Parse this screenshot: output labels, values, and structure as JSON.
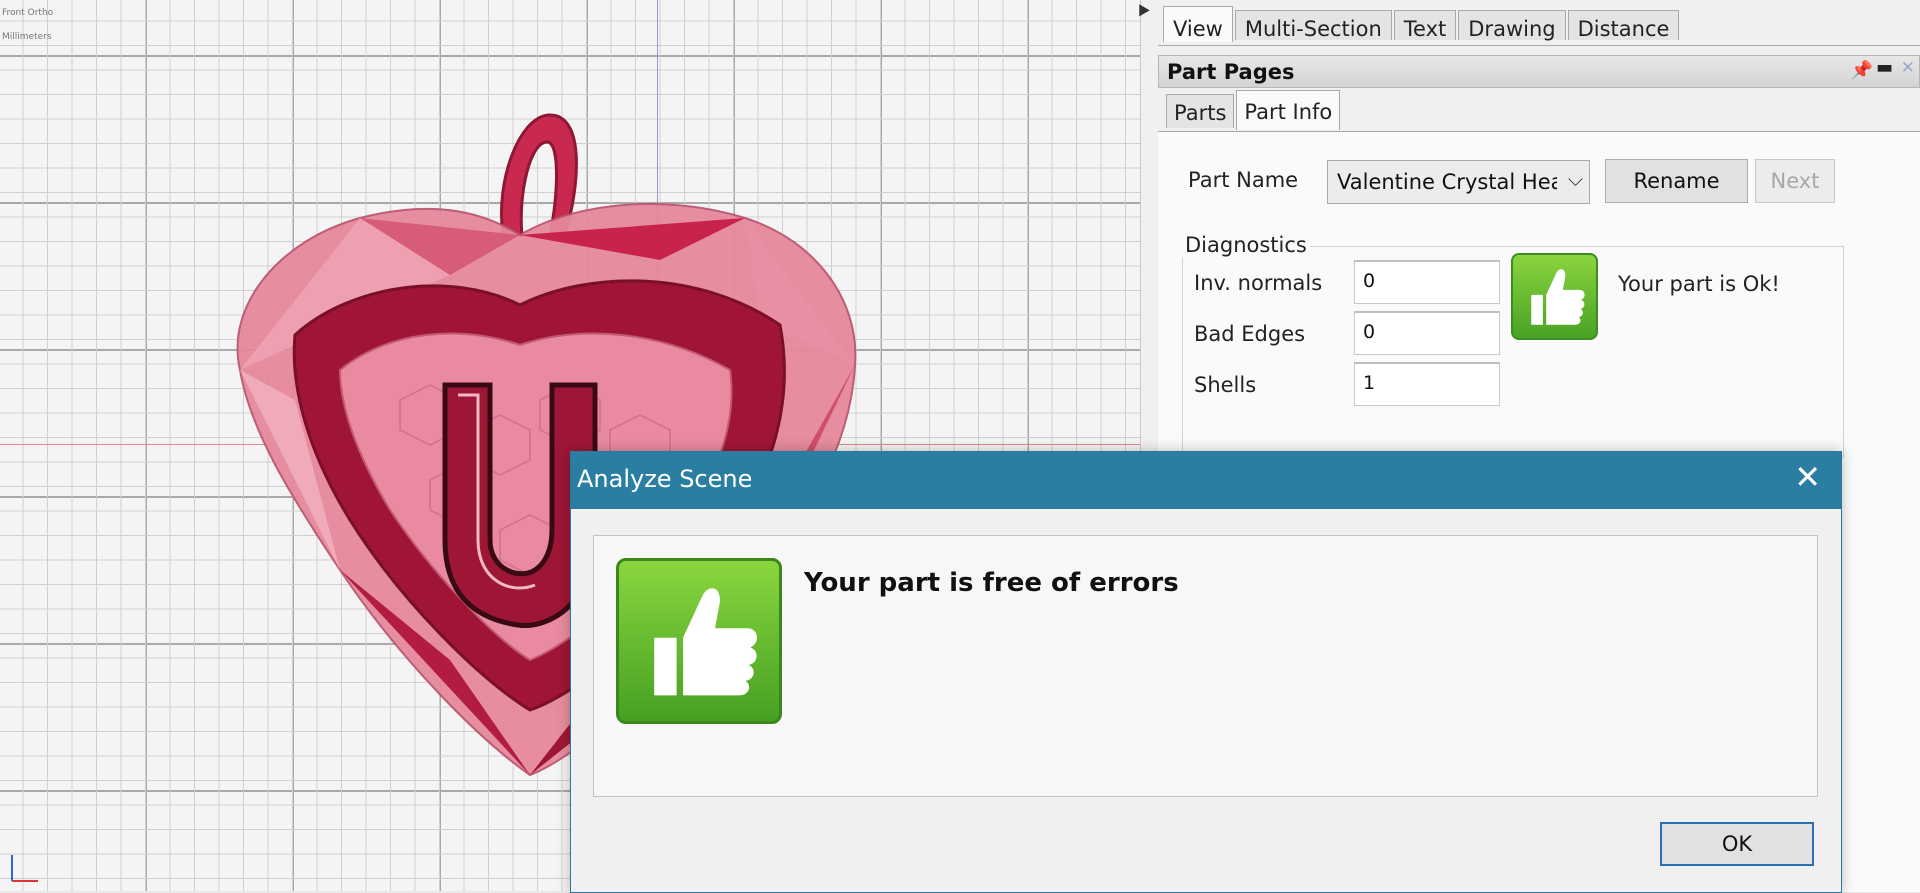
{
  "viewport": {
    "view_label": "Front Ortho",
    "units_label": "Millimeters"
  },
  "top_tabs": [
    "View",
    "Multi-Section",
    "Text",
    "Drawing",
    "Distance"
  ],
  "part_pages": {
    "title": "Part Pages",
    "tabs": [
      "Parts",
      "Part Info"
    ],
    "part_name_label": "Part Name",
    "part_name_value": "Valentine Crystal Hea",
    "rename_label": "Rename",
    "next_label": "Next",
    "diagnostics": {
      "title": "Diagnostics",
      "inv_normals_label": "Inv. normals",
      "inv_normals_value": "0",
      "bad_edges_label": "Bad Edges",
      "bad_edges_value": "0",
      "shells_label": "Shells",
      "shells_value": "1",
      "status_text": "Your part is Ok!"
    }
  },
  "dialog": {
    "title": "Analyze Scene",
    "message": "Your part is free of errors",
    "ok_label": "OK"
  },
  "colors": {
    "dialog_title_bar": "#2a7ea1",
    "thumb_green": "#5cb82d",
    "heart_red": "#c8234a"
  }
}
